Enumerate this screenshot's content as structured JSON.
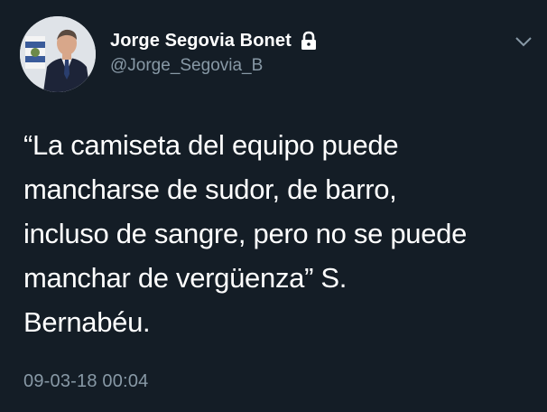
{
  "tweet": {
    "display_name": "Jorge Segovia Bonet",
    "handle": "@Jorge_Segovia_B",
    "text": "“La camiseta del equipo puede\nmancharse de sudor, de barro,\nincluso de sangre, pero no se puede\nmanchar de vergüenza” S.\nBernabéu.",
    "timestamp": "09-03-18 00:04",
    "protected_icon": "lock-icon",
    "menu_icon": "chevron-down-icon"
  },
  "colors": {
    "background": "#141d26",
    "primary_text": "#ffffff",
    "secondary_text": "#8899a6"
  }
}
